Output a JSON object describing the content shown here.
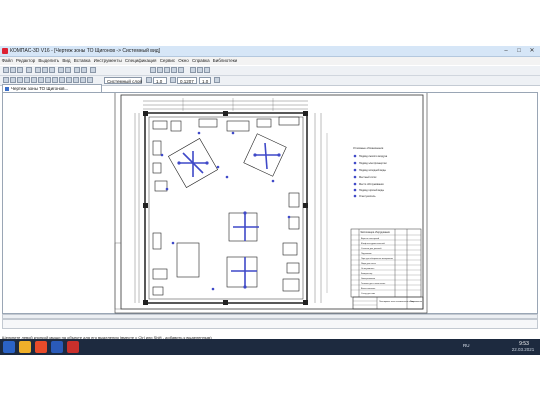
{
  "window": {
    "title": "КОМПАС-3D V16 - [Чертеж зоны ТО Щигонов -> Системный вид]",
    "minimize": "–",
    "maximize": "□",
    "close": "✕"
  },
  "menu": [
    "Файл",
    "Редактор",
    "Выделить",
    "Вид",
    "Вставка",
    "Инструменты",
    "Спецификация",
    "Сервис",
    "Окно",
    "Справка",
    "Библиотеки"
  ],
  "toolbar": {
    "layer_combo": "Системный слой",
    "step_value": "1.0",
    "zoom_value": "0.1207",
    "scale_value": "1.0"
  },
  "document_tab": {
    "label": "Чертеж зоны ТО Щигонов..."
  },
  "drawing": {
    "legend_title": "Условные обозначения",
    "legend_items": [
      "Подвод сжатого воздуха",
      "Подвод электроэнергии",
      "Подвод холодной воды",
      "Местный отсос",
      "Место обслуживания",
      "Подвод горячей воды",
      "Огнетушитель"
    ],
    "table_title": "Экспликация оборудования",
    "table_rows": [
      "Верстак слесарный",
      "Шкаф инструментальный",
      "Стеллаж для деталей",
      "Подъемник",
      "Ларь для обтирочных материалов",
      "Ящик для песка",
      "Огнетушитель",
      "Компрессор",
      "Электроточило",
      "Тележка для снятия колес",
      "Ванна моечная",
      "Стенд для шин"
    ],
    "stamp_title": "Планировка зоны технического обслуживания",
    "stamp_sheet": "Лист"
  },
  "status": {
    "hint": "Щелкните левой кнопкой мыши на объекте для его выделения (вместе с Ctrl или Shift - добавить к выделенным)"
  },
  "taskbar": {
    "language": "RU",
    "time": "9:53",
    "date": "22.03.2021"
  },
  "colors": {
    "accent": "#3f49c8",
    "taskbar": "#1d2a3f",
    "titlebar": "#d6e6f7"
  }
}
